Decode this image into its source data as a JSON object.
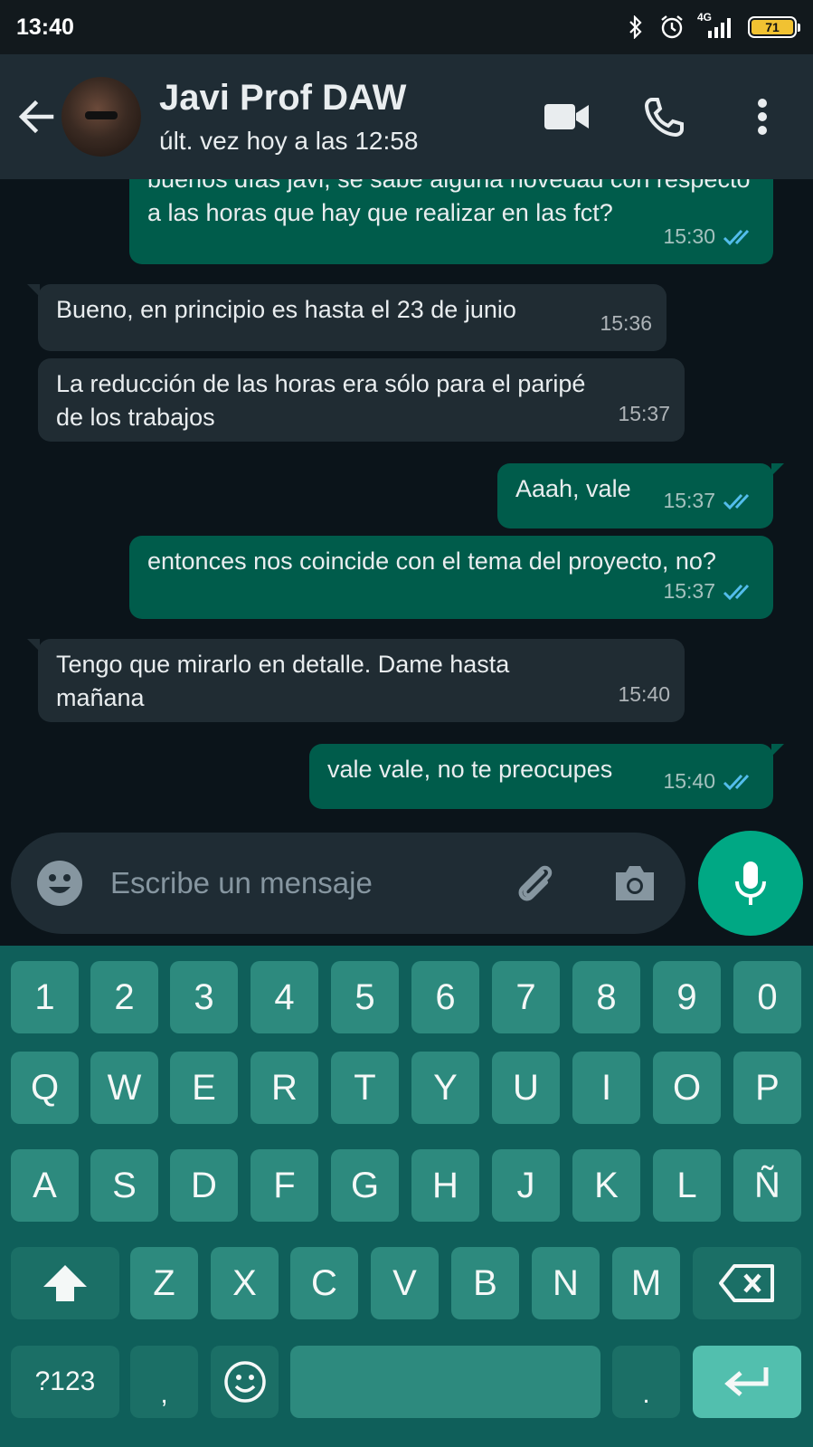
{
  "status_bar": {
    "time": "13:40",
    "network": "4G",
    "battery": "71"
  },
  "header": {
    "contact_name": "Javi Prof DAW",
    "last_seen": "últ. vez hoy a las 12:58"
  },
  "messages": [
    {
      "dir": "out",
      "text": "buenos días javi, se sabe alguna novedad con respecto a las horas que hay que realizar en las fct?",
      "time": "15:30"
    },
    {
      "dir": "in",
      "text": "Bueno, en principio es hasta el 23 de junio",
      "time": "15:36"
    },
    {
      "dir": "in",
      "text": "La reducción de las horas era sólo para el paripé de los trabajos",
      "time": "15:37"
    },
    {
      "dir": "out",
      "text": "Aaah, vale",
      "time": "15:37"
    },
    {
      "dir": "out",
      "text": "entonces nos coincide con el tema del proyecto, no?",
      "time": "15:37"
    },
    {
      "dir": "in",
      "text": "Tengo que mirarlo en detalle. Dame hasta mañana",
      "time": "15:40"
    },
    {
      "dir": "out",
      "text": "vale vale, no te preocupes",
      "time": "15:40"
    }
  ],
  "composer": {
    "placeholder": "Escribe un mensaje"
  },
  "keyboard": {
    "row_numbers": [
      "1",
      "2",
      "3",
      "4",
      "5",
      "6",
      "7",
      "8",
      "9",
      "0"
    ],
    "row_1": [
      "Q",
      "W",
      "E",
      "R",
      "T",
      "Y",
      "U",
      "I",
      "O",
      "P"
    ],
    "row_2": [
      "A",
      "S",
      "D",
      "F",
      "G",
      "H",
      "J",
      "K",
      "L",
      "Ñ"
    ],
    "row_3": [
      "Z",
      "X",
      "C",
      "V",
      "B",
      "N",
      "M"
    ],
    "symbols_key": "?123",
    "comma_key": ",",
    "period_key": "."
  },
  "colors": {
    "accent": "#00a884",
    "outgoing_bubble": "#005c4b",
    "incoming_bubble": "#202c33",
    "read_ticks": "#53bdeb",
    "keyboard_bg": "#0f5f5a"
  },
  "icons": [
    "back-arrow-icon",
    "video-call-icon",
    "voice-call-icon",
    "more-options-icon",
    "emoji-icon",
    "attach-icon",
    "camera-icon",
    "mic-icon",
    "shift-icon",
    "backspace-icon",
    "enter-icon",
    "bluetooth-icon",
    "alarm-icon",
    "signal-icon",
    "battery-icon",
    "double-check-icon"
  ]
}
